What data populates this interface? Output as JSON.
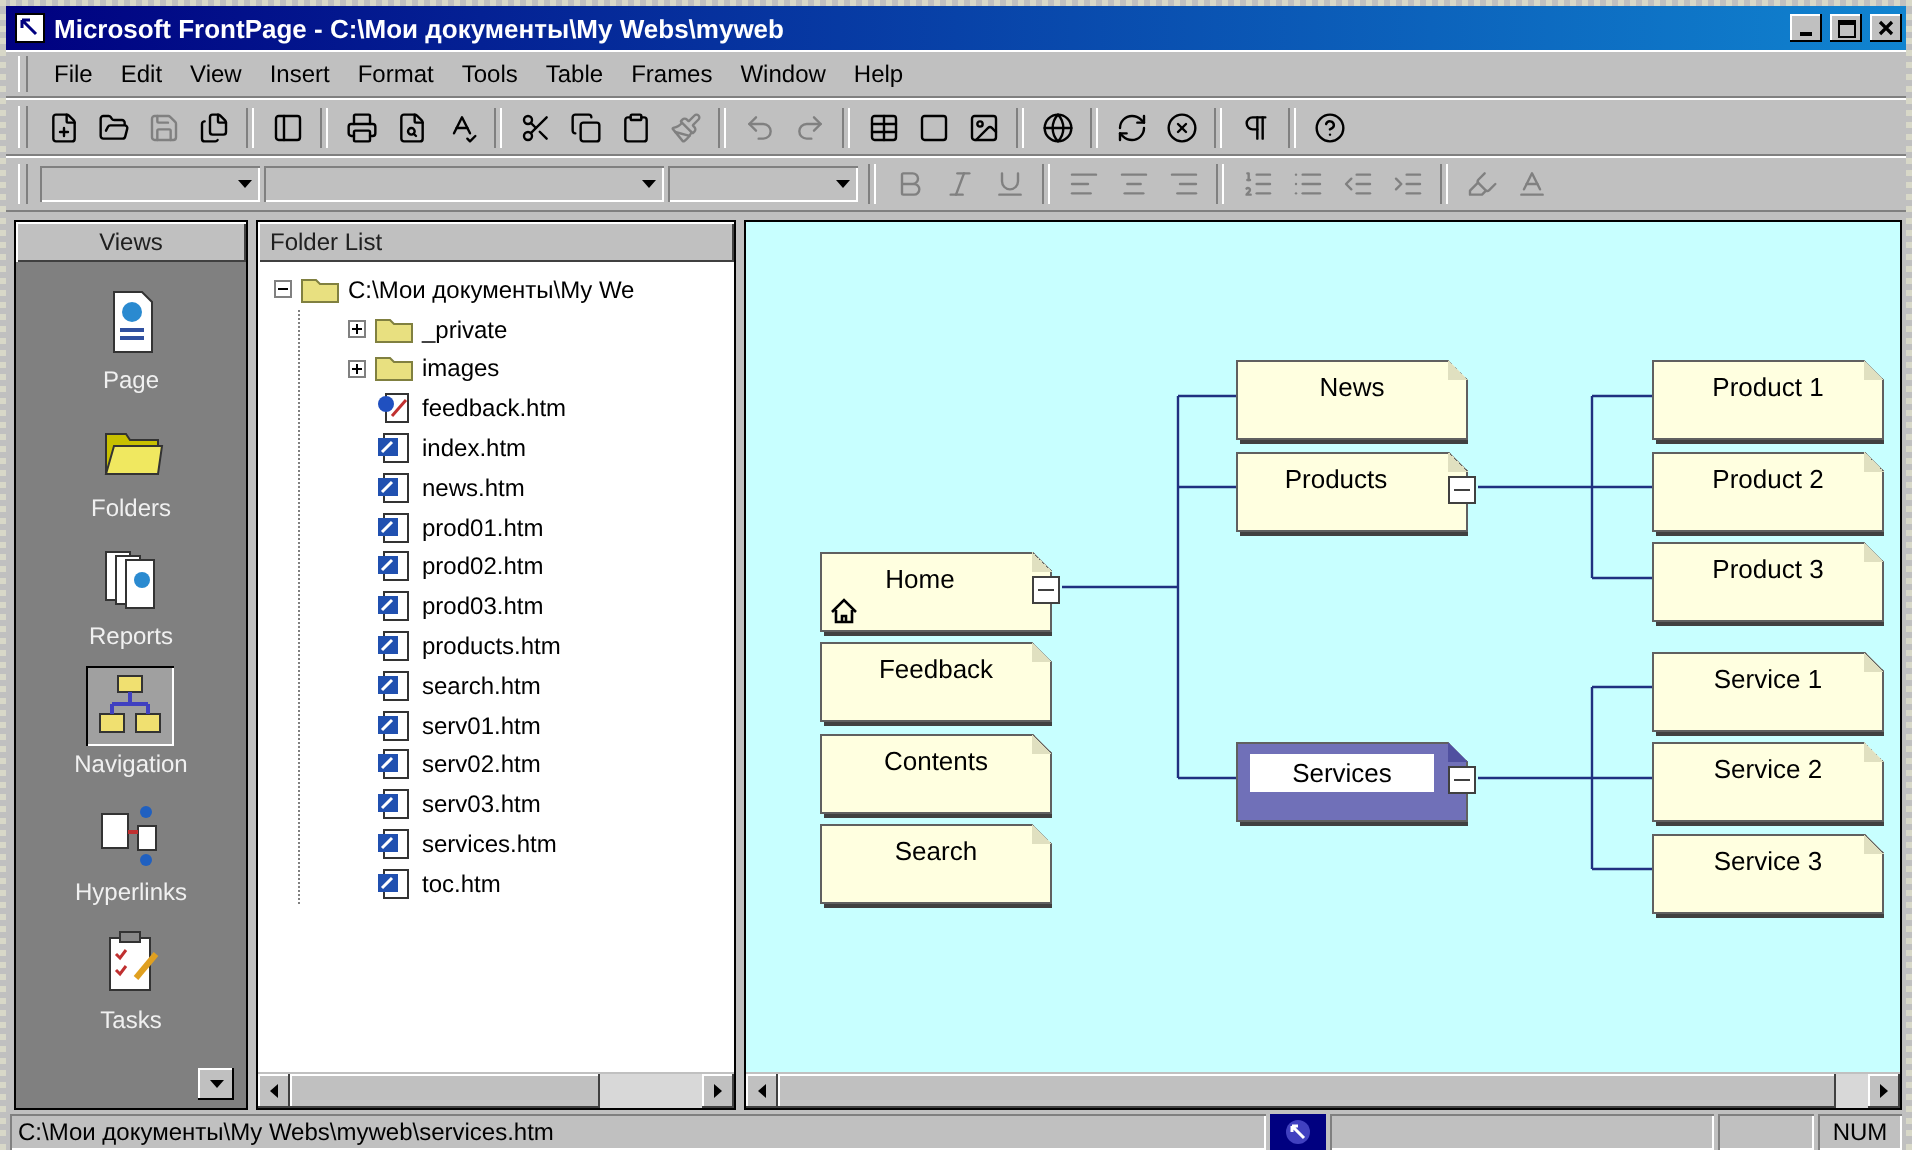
{
  "window": {
    "title": "Microsoft FrontPage - C:\\Мои документы\\My Webs\\myweb"
  },
  "menu": [
    {
      "label": "File"
    },
    {
      "label": "Edit"
    },
    {
      "label": "View"
    },
    {
      "label": "Insert"
    },
    {
      "label": "Format"
    },
    {
      "label": "Tools"
    },
    {
      "label": "Table"
    },
    {
      "label": "Frames"
    },
    {
      "label": "Window"
    },
    {
      "label": "Help"
    }
  ],
  "views": {
    "title": "Views",
    "items": [
      {
        "label": "Page",
        "kind": "page",
        "selected": false
      },
      {
        "label": "Folders",
        "kind": "folders",
        "selected": false
      },
      {
        "label": "Reports",
        "kind": "reports",
        "selected": false
      },
      {
        "label": "Navigation",
        "kind": "navigation",
        "selected": true
      },
      {
        "label": "Hyperlinks",
        "kind": "hyperlinks",
        "selected": false
      },
      {
        "label": "Tasks",
        "kind": "tasks",
        "selected": false
      }
    ]
  },
  "folder_list": {
    "title": "Folder List",
    "tree": [
      {
        "label": "C:\\Мои документы\\My We",
        "kind": "folder",
        "expanded": true,
        "children": [
          {
            "label": "_private",
            "kind": "folder",
            "expanded": false
          },
          {
            "label": "images",
            "kind": "folder",
            "expanded": false
          },
          {
            "label": "feedback.htm",
            "kind": "form"
          },
          {
            "label": "index.htm",
            "kind": "page"
          },
          {
            "label": "news.htm",
            "kind": "page"
          },
          {
            "label": "prod01.htm",
            "kind": "page"
          },
          {
            "label": "prod02.htm",
            "kind": "page"
          },
          {
            "label": "prod03.htm",
            "kind": "page"
          },
          {
            "label": "products.htm",
            "kind": "page"
          },
          {
            "label": "search.htm",
            "kind": "page"
          },
          {
            "label": "serv01.htm",
            "kind": "page"
          },
          {
            "label": "serv02.htm",
            "kind": "page"
          },
          {
            "label": "serv03.htm",
            "kind": "page"
          },
          {
            "label": "services.htm",
            "kind": "page"
          },
          {
            "label": "toc.htm",
            "kind": "page"
          }
        ]
      }
    ]
  },
  "navigation": {
    "root": {
      "label": "Home",
      "kind": "home",
      "selected": false,
      "expanded": true,
      "children": [
        {
          "label": "News",
          "selected": false
        },
        {
          "label": "Products",
          "selected": false,
          "expanded": true,
          "children": [
            {
              "label": "Product 1",
              "selected": false
            },
            {
              "label": "Product 2",
              "selected": false
            },
            {
              "label": "Product 3",
              "selected": false
            }
          ]
        },
        {
          "label": "Services",
          "selected": true,
          "expanded": true,
          "children": [
            {
              "label": "Service 1",
              "selected": false
            },
            {
              "label": "Service 2",
              "selected": false
            },
            {
              "label": "Service 3",
              "selected": false
            }
          ]
        }
      ]
    },
    "unlinked": [
      {
        "label": "Feedback",
        "selected": false
      },
      {
        "label": "Contents",
        "selected": false
      },
      {
        "label": "Search",
        "selected": false
      }
    ]
  },
  "status_bar": {
    "path": "C:\\Мои документы\\My Webs\\myweb\\services.htm",
    "indicator": "NUM"
  }
}
